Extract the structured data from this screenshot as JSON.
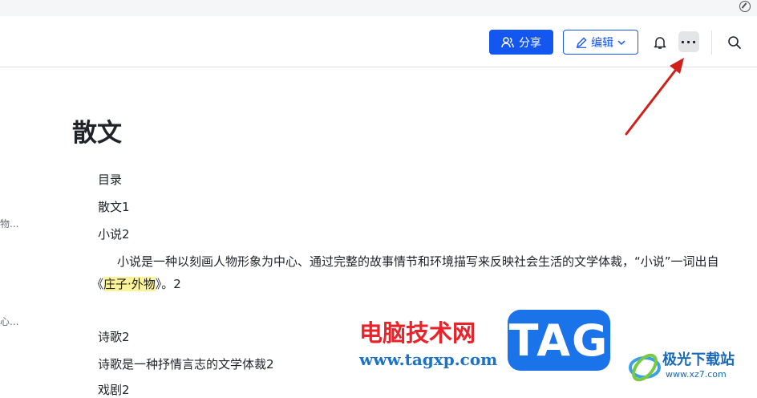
{
  "toolbar": {
    "share_label": "分享",
    "edit_label": "编辑",
    "more_label": "···"
  },
  "toc": {
    "items": [
      "物...",
      "心..."
    ]
  },
  "document": {
    "title": "散文",
    "lines": {
      "toc": "目录",
      "sanwen1": "散文1",
      "xiaoshuo2": "小说2",
      "para_before": "小说是一种以刻画人物形象为中心、通过完整的故事情节和环境描写来反映社会生活的文学体裁，“小说”一词出自《",
      "para_highlight": "庄子·外物",
      "para_after": "》。2",
      "shige2": "诗歌2",
      "shige_desc": "诗歌是一种抒情言志的文学体裁2",
      "xiju": "戏剧2"
    }
  },
  "watermark": {
    "cn": "电脑技术网",
    "url": "www.tagxp.com",
    "tag": "TAG",
    "site2_cn": "极光下载站",
    "site2_url": "www.xz7.com"
  },
  "colors": {
    "primary": "#1456f0",
    "highlight": "#fbf39a",
    "arrow": "#d0201c"
  }
}
